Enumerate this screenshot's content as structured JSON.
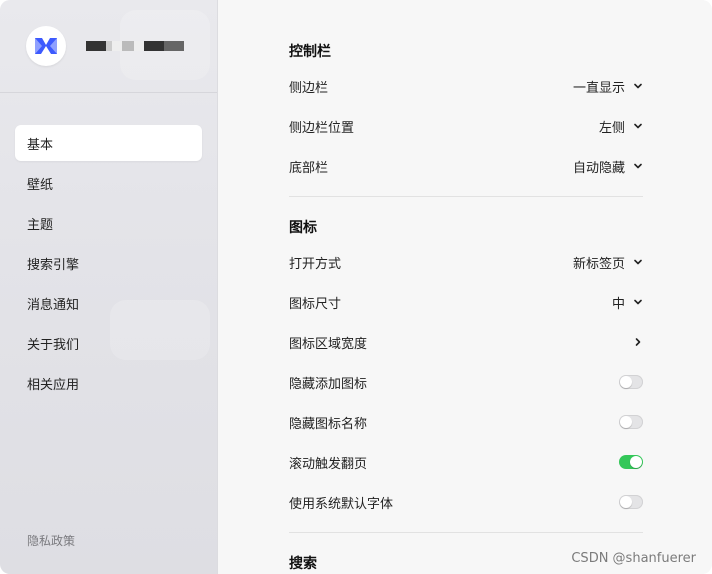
{
  "sidebar": {
    "items": [
      {
        "label": "基本",
        "active": true
      },
      {
        "label": "壁纸"
      },
      {
        "label": "主题"
      },
      {
        "label": "搜索引擎"
      },
      {
        "label": "消息通知"
      },
      {
        "label": "关于我们"
      },
      {
        "label": "相关应用"
      }
    ],
    "privacy_label": "隐私政策"
  },
  "sections": {
    "control_bar": {
      "title": "控制栏",
      "sidebar_label": "侧边栏",
      "sidebar_value": "一直显示",
      "sidebar_pos_label": "侧边栏位置",
      "sidebar_pos_value": "左侧",
      "bottom_bar_label": "底部栏",
      "bottom_bar_value": "自动隐藏"
    },
    "icons": {
      "title": "图标",
      "open_mode_label": "打开方式",
      "open_mode_value": "新标签页",
      "icon_size_label": "图标尺寸",
      "icon_size_value": "中",
      "area_width_label": "图标区域宽度",
      "hide_add_label": "隐藏添加图标",
      "hide_add_on": false,
      "hide_name_label": "隐藏图标名称",
      "hide_name_on": false,
      "scroll_page_label": "滚动触发翻页",
      "scroll_page_on": true,
      "system_font_label": "使用系统默认字体",
      "system_font_on": false
    },
    "search": {
      "title": "搜索"
    }
  },
  "watermark": "CSDN @shanfuerer",
  "colors": {
    "toggle_on": "#34c759",
    "logo_blue": "#3d5afe"
  }
}
